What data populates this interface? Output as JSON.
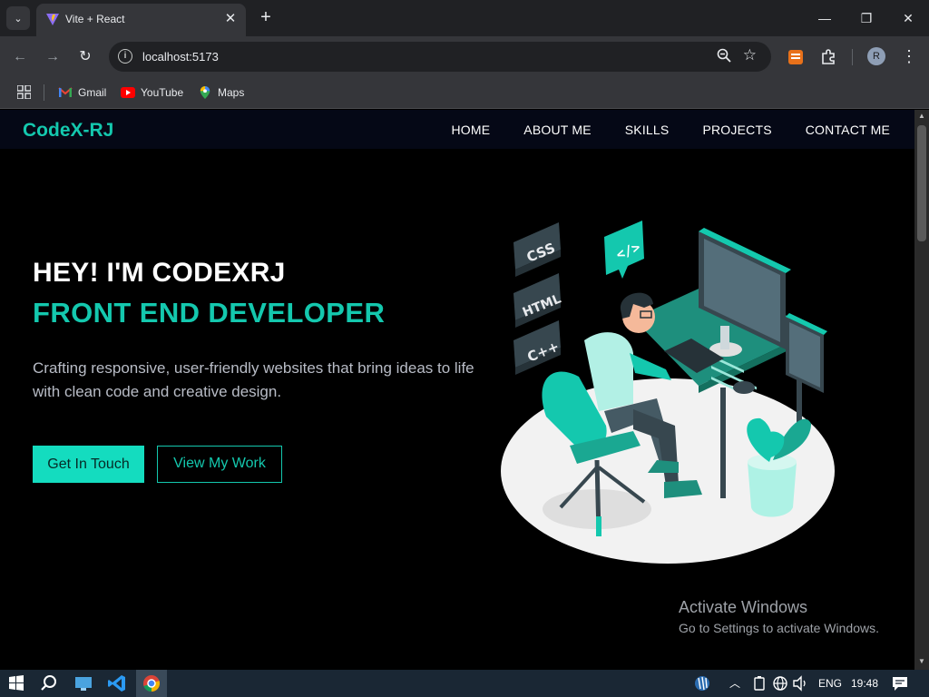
{
  "browser": {
    "tab_title": "Vite + React",
    "tab_close": "✕",
    "new_tab": "+",
    "url": "localhost:5173",
    "minimize": "—",
    "restore": "❐",
    "close": "✕",
    "profile_initial": "R",
    "bookmarks": [
      {
        "label": "Gmail",
        "icon": "gmail-icon"
      },
      {
        "label": "YouTube",
        "icon": "youtube-icon"
      },
      {
        "label": "Maps",
        "icon": "maps-icon"
      }
    ]
  },
  "site": {
    "logo": "CodeX-RJ",
    "nav": [
      "HOME",
      "ABOUT ME",
      "SKILLS",
      "PROJECTS",
      "CONTACT ME"
    ],
    "hero": {
      "greeting": "HEY! I'M CODEXRJ",
      "role": "FRONT END DEVELOPER",
      "description": "Crafting responsive, user-friendly websites that bring ideas to life with clean code and creative design.",
      "primary_button": "Get In Touch",
      "secondary_button": "View My Work"
    },
    "illustration": {
      "badges": [
        "CSS",
        "HTML",
        "C++"
      ],
      "code_bubble": "</>"
    },
    "accent_color": "#14c8ae"
  },
  "watermark": {
    "title": "Activate Windows",
    "subtitle": "Go to Settings to activate Windows."
  },
  "taskbar": {
    "language": "ENG",
    "time": "19:48"
  }
}
